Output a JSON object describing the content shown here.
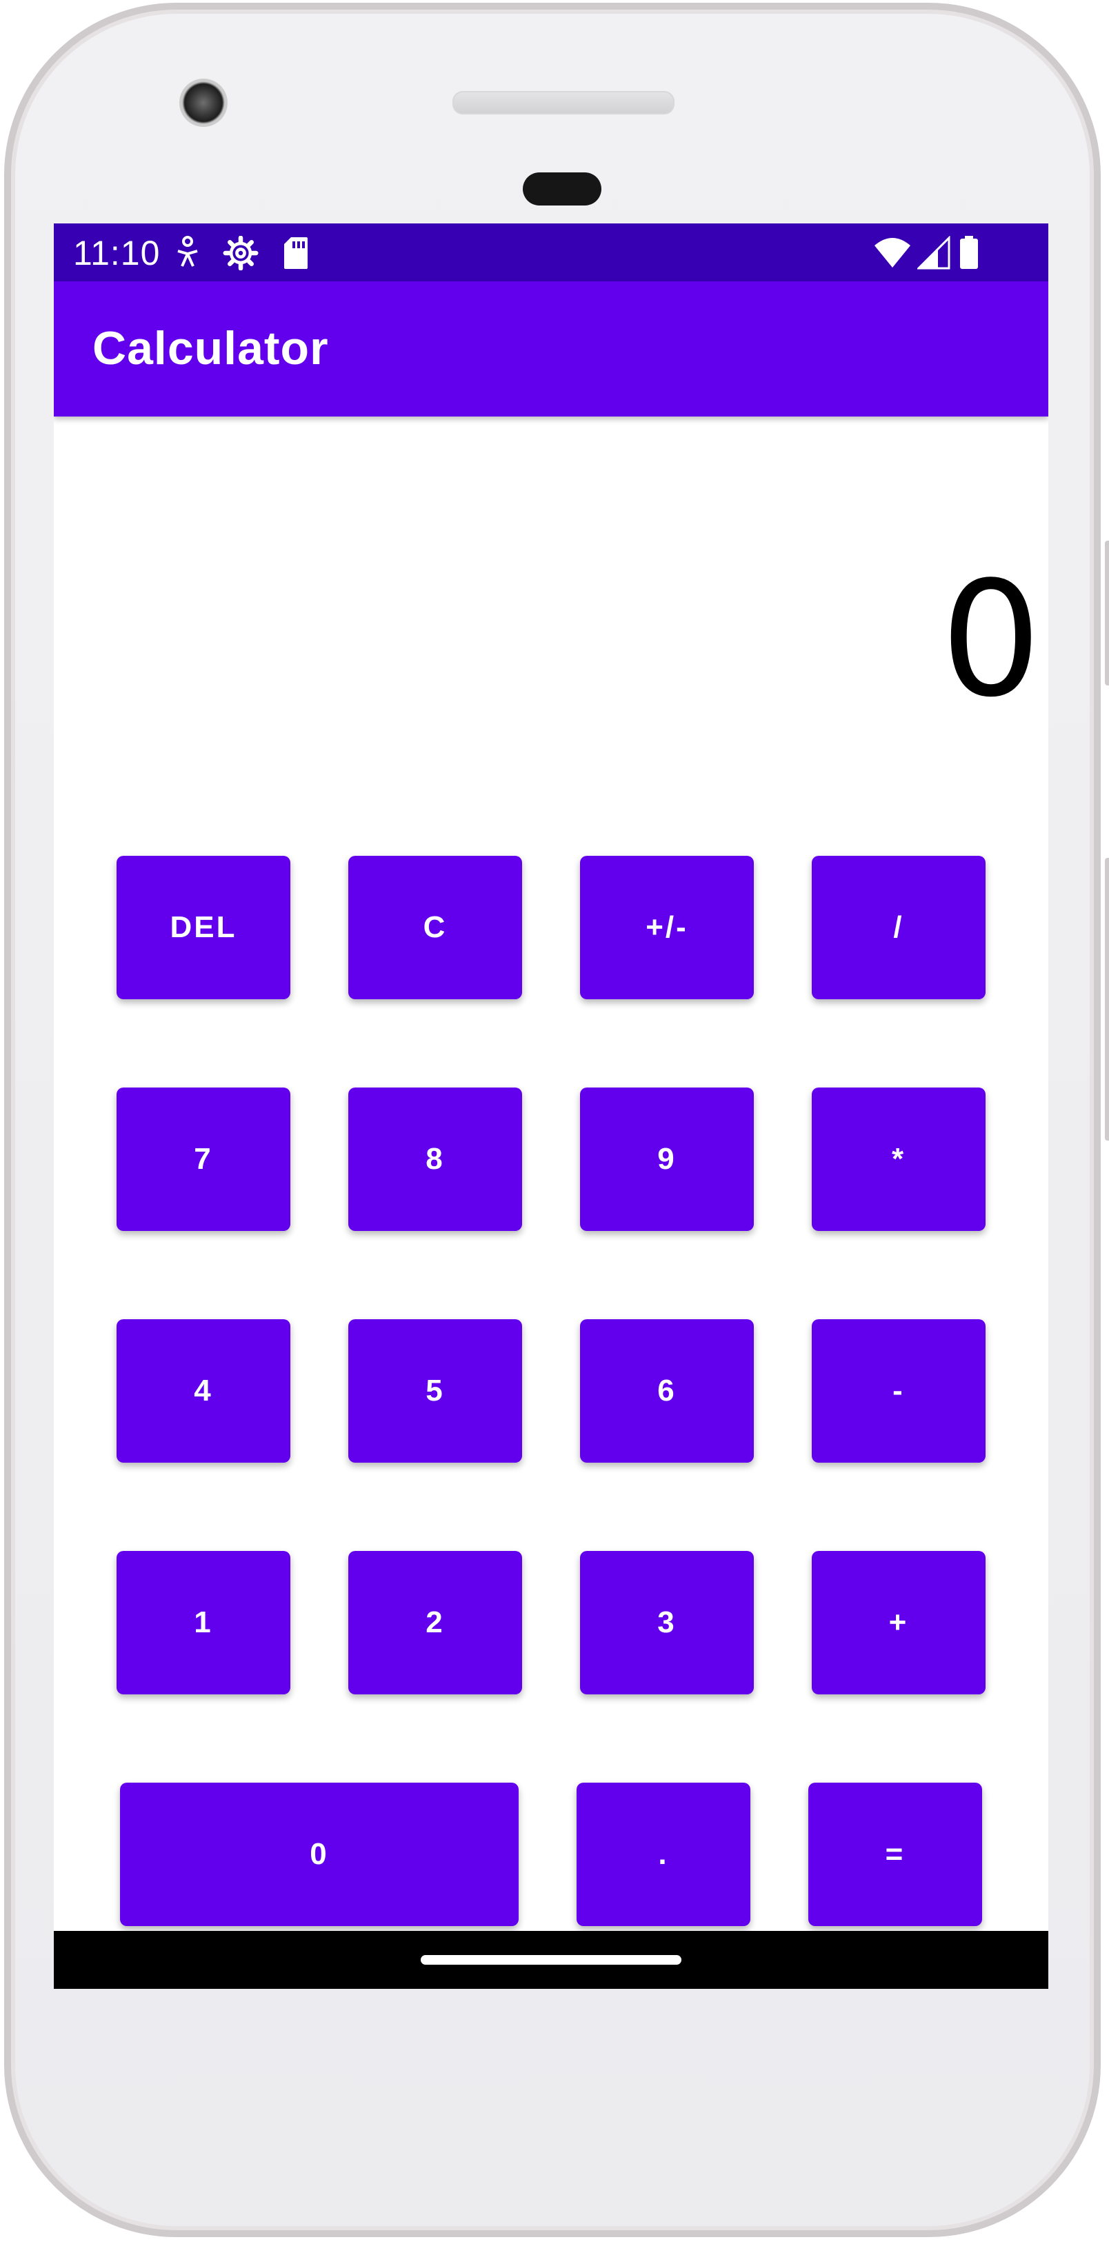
{
  "status_bar": {
    "time": "11:10",
    "left_icons": [
      "accessibility-icon",
      "settings-gear-icon",
      "sd-card-icon"
    ],
    "right_icons": [
      "wifi-icon",
      "signal-icon",
      "battery-icon"
    ]
  },
  "app_bar": {
    "title": "Calculator"
  },
  "display": {
    "value": "0"
  },
  "keypad": {
    "del": "DEL",
    "clear": "C",
    "negate": "+/-",
    "divide": "/",
    "seven": "7",
    "eight": "8",
    "nine": "9",
    "multiply": "*",
    "four": "4",
    "five": "5",
    "six": "6",
    "subtract": "-",
    "one": "1",
    "two": "2",
    "three": "3",
    "add": "+",
    "zero": "0",
    "decimal": ".",
    "equals": "="
  },
  "colors": {
    "primary": "#6200ee",
    "primary_dark": "#3700b3",
    "on_primary": "#ffffff"
  }
}
